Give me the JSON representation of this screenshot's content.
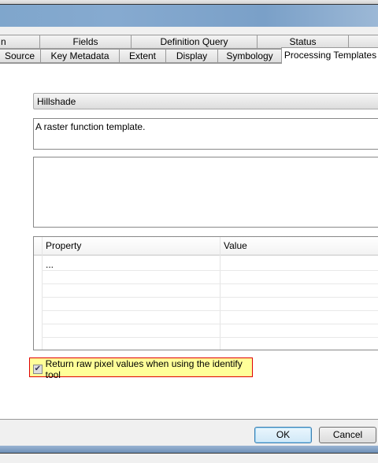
{
  "tabs_row1": [
    "n",
    "Fields",
    "Definition Query",
    "Status",
    ""
  ],
  "tabs_row2": [
    "Source",
    "Key Metadata",
    "Extent",
    "Display",
    "Symbology",
    "Processing Templates"
  ],
  "template_select": "Hillshade",
  "description": "A raster function template.",
  "grid": {
    "headers": [
      "Property",
      "Value"
    ],
    "rows": [
      [
        "...",
        ""
      ]
    ]
  },
  "identify_checkbox": {
    "label": "Return raw pixel values when using the identify tool",
    "checked": true
  },
  "buttons": {
    "ok": "OK",
    "cancel": "Cancel"
  }
}
